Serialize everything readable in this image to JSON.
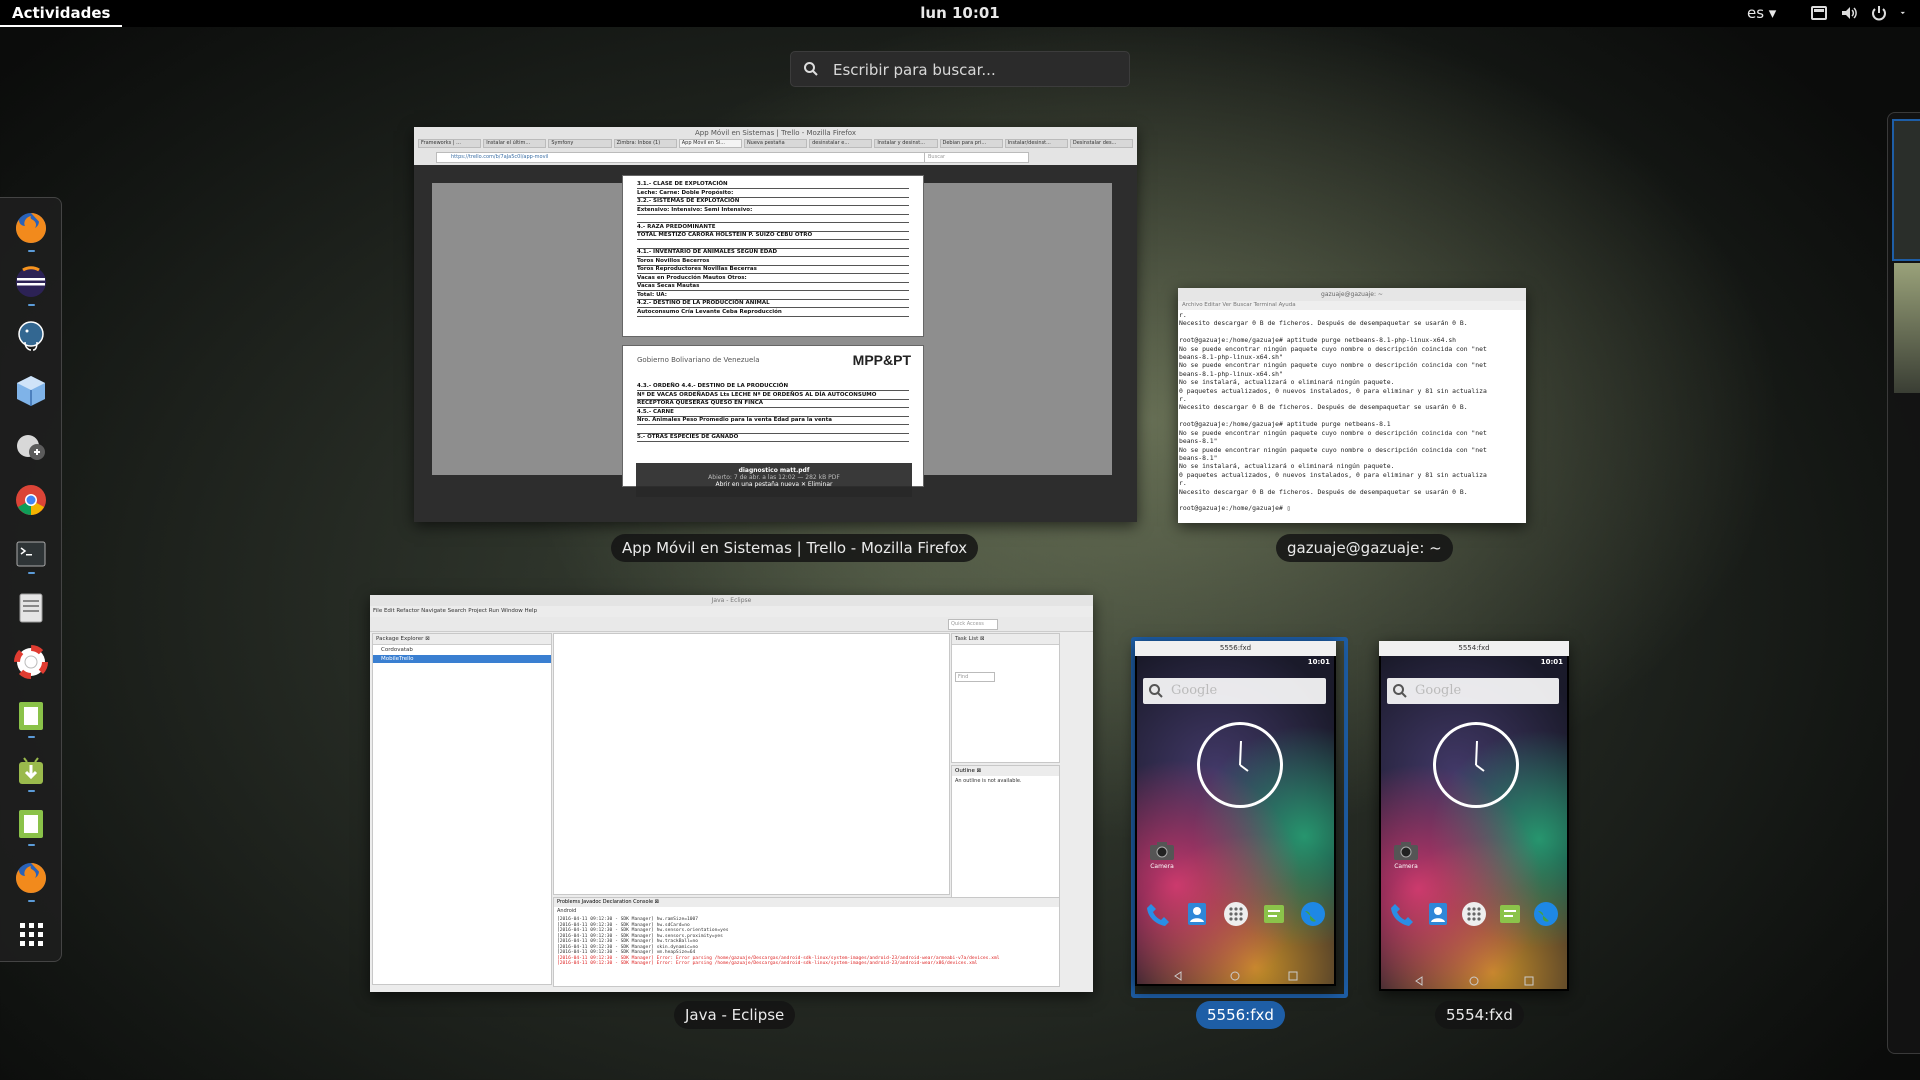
{
  "topbar": {
    "activities": "Actividades",
    "clock": "lun 10:01",
    "language": "es ▾"
  },
  "search": {
    "placeholder": "Escribir para buscar..."
  },
  "dash": {
    "apps": [
      "firefox-icon",
      "eclipse-icon",
      "postgresql-icon",
      "virtualbox-icon",
      "remmina-icon",
      "chrome-icon",
      "terminal-icon",
      "files-icon",
      "help-icon",
      "android-emulator-icon",
      "android-downloader-icon",
      "android-emulator-2-icon",
      "firefox-2-icon",
      "show-apps-icon"
    ]
  },
  "windows": {
    "firefox": {
      "caption": "App Móvil en Sistemas | Trello - Mozilla Firefox",
      "title": "App Móvil en Sistemas | Trello - Mozilla Firefox",
      "tabs": [
        "Frameworks | ...",
        "Instalar el últim...",
        "Symfony",
        "Zimbra: Inbox (1)",
        "App Móvil en Si...",
        "Nueva pestaña",
        "desinstalar e...",
        "Instalar y desinst...",
        "Debian para pri...",
        "Instalar/desinst...",
        "Desinstalar des..."
      ],
      "url": "https://trello.com/b/7aJa5c0l/app-movil",
      "search_placeholder": "Buscar",
      "pdf": {
        "rows1": [
          "3.1.- CLASE DE EXPLOTACIÓN",
          "Leche:            Carne:            Doble Propósito:",
          "3.2.- SISTEMAS DE EXPLOTACIÓN",
          "Extensivo:        Intensivo:        Semi Intensivo:",
          "",
          "4.- RAZA PREDOMINANTE",
          "TOTAL  MESTIZO  CARORA  HOLSTEIN  P. SUIZO  CEBU  OTRO",
          "",
          "4.1.- INVENTARIO DE ANIMALES SEGÚN EDAD",
          "Toros              Novillos          Becerros",
          "Toros Reproductores  Novillas        Becerras",
          "Vacas en Producción  Mautos          Otros:",
          "Vacas Secas          Mautas",
          "Total:                       UA:",
          "4.2.- DESTINO DE LA PRODUCCIÓN ANIMAL",
          "Autoconsumo      Cría   Levante   Ceba   Reproducción"
        ],
        "header2_left": "Gobierno Bolivariano de Venezuela",
        "header2_right": "MPP&PT",
        "rows2": [
          "4.3.- ORDEÑO          4.4.- DESTINO DE LA PRODUCCIÓN",
          "Nº DE VACAS ORDEÑADAS  Lts LECHE  Nº DE ORDEÑOS AL DÍA  AUTOCONSUMO  RECEPTORA  QUESERAS  QUESO EN FINCA",
          "",
          "4.5.- CARNE",
          "Nro. Animales    Peso Promedio para la venta    Edad para la venta",
          "",
          "5.- OTRAS ESPECIES DE GANADO"
        ]
      },
      "download": {
        "file": "diagnostico matt.pdf",
        "info": "Abierto: 7 de abr. a las 12:02 — 282 kB PDF",
        "open": "Abrir en una pestaña nueva",
        "delete": "Eliminar"
      }
    },
    "terminal": {
      "caption": "gazuaje@gazuaje: ~",
      "title": "gazuaje@gazuaje: ~",
      "menu": "Archivo   Editar   Ver   Buscar   Terminal   Ayuda",
      "lines": [
        "r.",
        "Necesito descargar 0 B de ficheros. Después de desempaquetar se usarán 0 B.",
        "",
        "root@gazuaje:/home/gazuaje# aptitude purge netbeans-8.1-php-linux-x64.sh",
        "No se puede encontrar ningún paquete cuyo nombre o descripción coincida con \"net",
        "beans-8.1-php-linux-x64.sh\"",
        "No se puede encontrar ningún paquete cuyo nombre o descripción coincida con \"net",
        "beans-8.1-php-linux-x64.sh\"",
        "No se instalará, actualizará o eliminará ningún paquete.",
        "0 paquetes actualizados, 0 nuevos instalados, 0 para eliminar y 81 sin actualiza",
        "r.",
        "Necesito descargar 0 B de ficheros. Después de desempaquetar se usarán 0 B.",
        "",
        "root@gazuaje:/home/gazuaje# aptitude purge netbeans-8.1",
        "No se puede encontrar ningún paquete cuyo nombre o descripción coincida con \"net",
        "beans-8.1\"",
        "No se puede encontrar ningún paquete cuyo nombre o descripción coincida con \"net",
        "beans-8.1\"",
        "No se instalará, actualizará o eliminará ningún paquete.",
        "0 paquetes actualizados, 0 nuevos instalados, 0 para eliminar y 81 sin actualiza",
        "r.",
        "Necesito descargar 0 B de ficheros. Después de desempaquetar se usarán 0 B.",
        "",
        "root@gazuaje:/home/gazuaje# ▯"
      ]
    },
    "eclipse": {
      "caption": "Java - Eclipse",
      "title": "Java - Eclipse",
      "menu": "File  Edit  Refactor  Navigate  Search  Project  Run  Window  Help",
      "quick_access": "Quick Access",
      "package_explorer": "Package Explorer ⊠",
      "projects": [
        "Cordovatab",
        "MobileTrello"
      ],
      "task_list": "Task List ⊠",
      "find": "Find",
      "outline": "Outline ⊠",
      "outline_msg": "An outline is not available.",
      "console_tabs": "Problems   Javadoc   Declaration   Console ⊠",
      "console_label": "Android",
      "console_lines": [
        "[2016-04-11 09:12:30 - SDK Manager] hw.ramSize=1007",
        "[2016-04-11 09:12:30 - SDK Manager] hw.sdCard=no",
        "[2016-04-11 09:12:30 - SDK Manager] hw.sensors.orientation=yes",
        "[2016-04-11 09:12:30 - SDK Manager] hw.sensors.proximity=yes",
        "[2016-04-11 09:12:30 - SDK Manager] hw.trackBall=no",
        "[2016-04-11 09:12:30 - SDK Manager] skin.dynamic=no",
        "[2016-04-11 09:12:30 - SDK Manager] vm.heapSize=64",
        "[2016-04-11 09:12:30 - SDK Manager] Error: Error parsing /home/gazuaje/Descargas/android-sdk-linux/system-images/android-23/android-wear/armeabi-v7a/devices.xml",
        "[2016-04-11 09:12:30 - SDK Manager] Error: Error parsing /home/gazuaje/Descargas/android-sdk-linux/system-images/android-23/android-wear/x86/devices.xml"
      ]
    },
    "emu1": {
      "caption": "5556:fxd",
      "title": "5556:fxd",
      "time": "10:01",
      "search": "Google",
      "camera": "Camera"
    },
    "emu2": {
      "caption": "5554:fxd",
      "title": "5554:fxd",
      "time": "10:01",
      "search": "Google",
      "camera": "Camera"
    }
  }
}
